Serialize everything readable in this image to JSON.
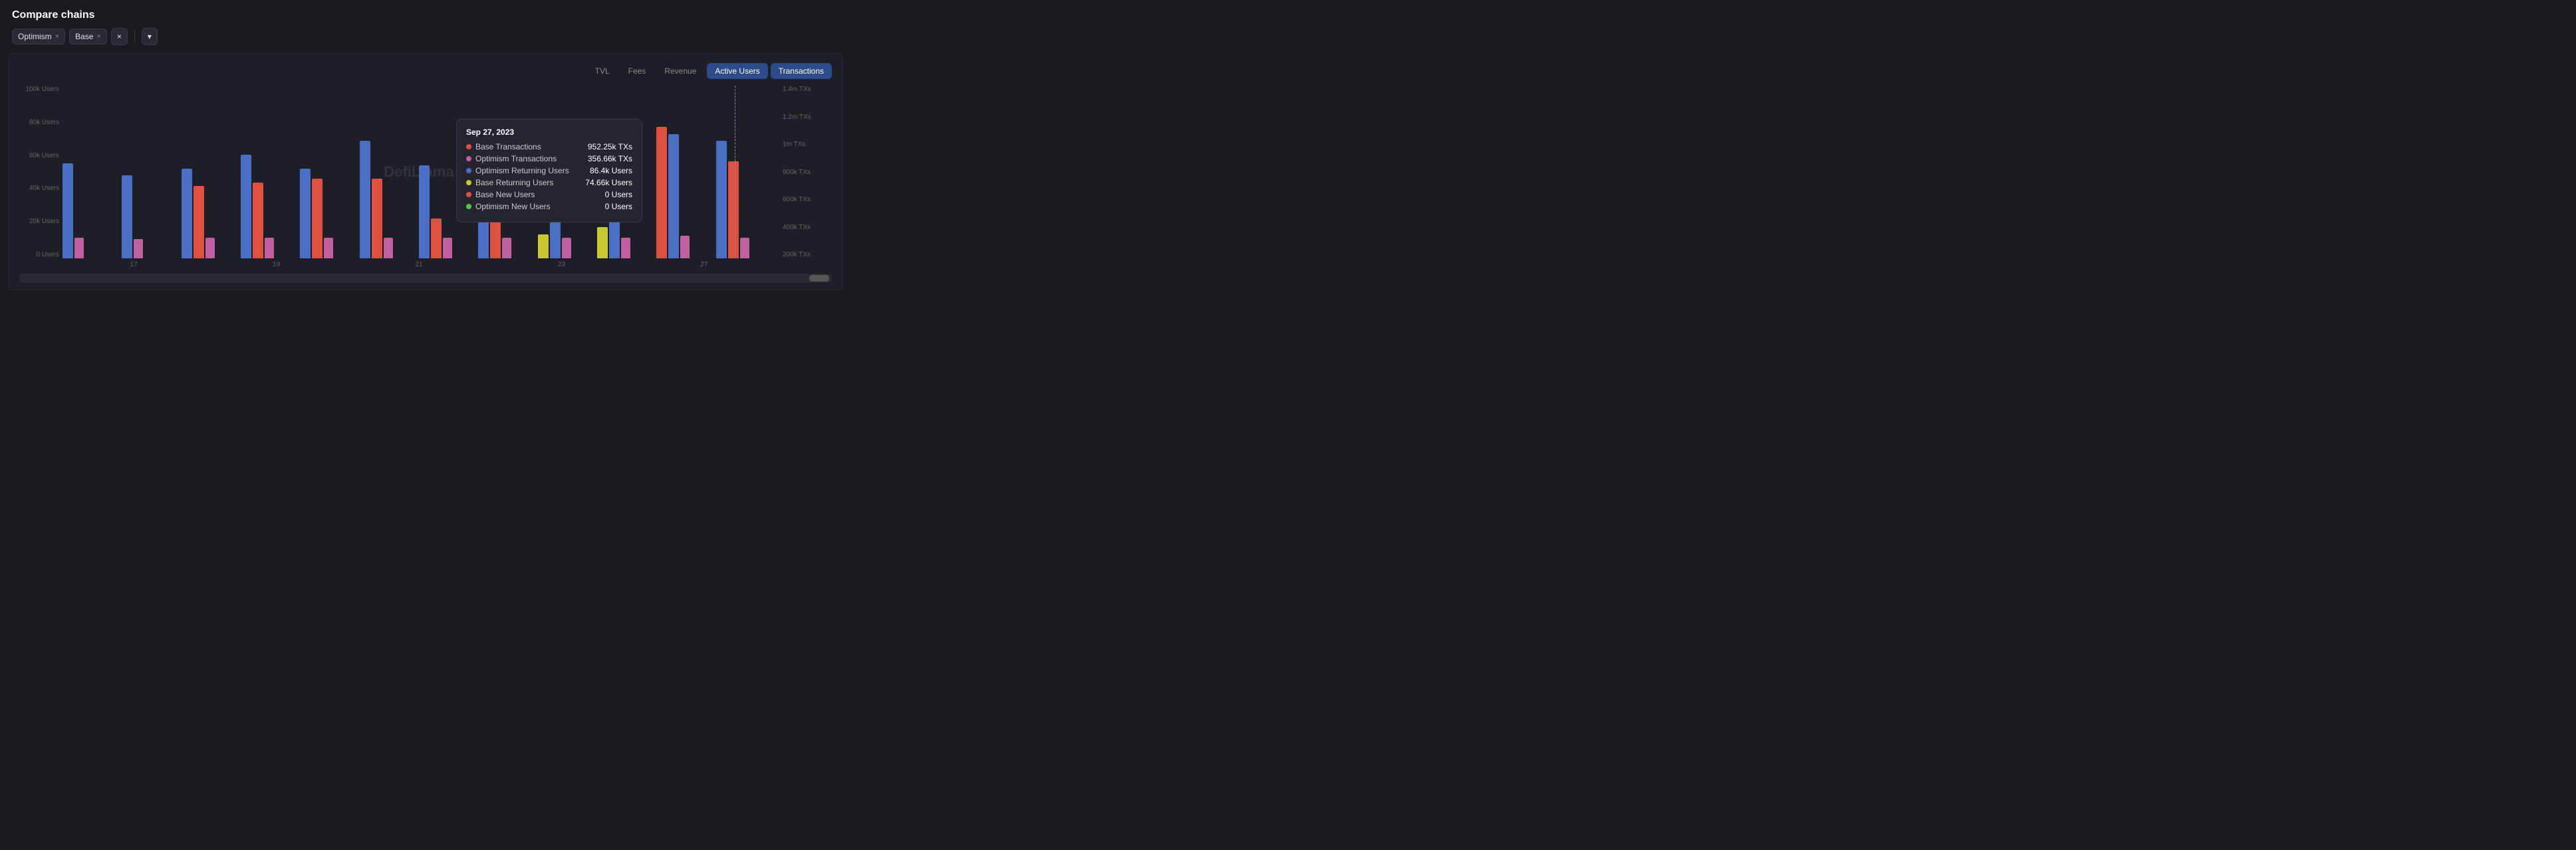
{
  "page": {
    "title": "Compare chains"
  },
  "filters": {
    "chains": [
      {
        "id": "optimism",
        "label": "Optimism"
      },
      {
        "id": "base",
        "label": "Base"
      }
    ],
    "clear_label": "×",
    "dropdown_label": "▾"
  },
  "chart": {
    "tabs": [
      {
        "id": "tvl",
        "label": "TVL",
        "active": false
      },
      {
        "id": "fees",
        "label": "Fees",
        "active": false
      },
      {
        "id": "revenue",
        "label": "Revenue",
        "active": false
      },
      {
        "id": "active_users",
        "label": "Active Users",
        "active": true
      },
      {
        "id": "transactions",
        "label": "Transactions",
        "active": true
      }
    ],
    "y_axis_left": [
      "100k Users",
      "80k Users",
      "60k Users",
      "40k Users",
      "20k Users",
      "0 Users"
    ],
    "y_axis_right": [
      "1.4m TXs",
      "1.2m TXs",
      "1m TXs",
      "800k TXs",
      "600k TXs",
      "400k TXs",
      "200k TXs"
    ],
    "x_labels": [
      "17",
      "19",
      "21",
      "23",
      "27"
    ],
    "watermark": "DefiLlama",
    "scrollbar": {
      "label": "scrollbar"
    }
  },
  "tooltip": {
    "date": "Sep 27, 2023",
    "rows": [
      {
        "color": "#e05040",
        "label": "Base Transactions",
        "value": "952.25k TXs"
      },
      {
        "color": "#c060a0",
        "label": "Optimism Transactions",
        "value": "356.66k TXs"
      },
      {
        "color": "#4a6fc4",
        "label": "Optimism Returning Users",
        "value": "86.4k Users"
      },
      {
        "color": "#c8c830",
        "label": "Base Returning Users",
        "value": "74.66k Users"
      },
      {
        "color": "#e05040",
        "label": "Base New Users",
        "value": "0 Users"
      },
      {
        "color": "#50c840",
        "label": "Optimism New Users",
        "value": "0 Users"
      }
    ]
  },
  "legend": {
    "base_new_users": "Base New Users"
  }
}
